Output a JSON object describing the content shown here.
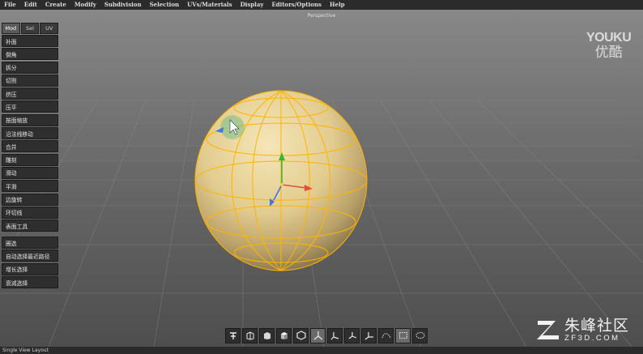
{
  "menu": [
    "File",
    "Edit",
    "Create",
    "Modify",
    "Subdivision",
    "Selection",
    "UVs/Materials",
    "Display",
    "Editors/Options",
    "Help"
  ],
  "viewport": {
    "title": "Perspective"
  },
  "panel": {
    "tabs": [
      "Mod",
      "Sel",
      "UV"
    ],
    "active_tab": "Mod",
    "tools": [
      "补面",
      "倒角",
      "拆分",
      "切割",
      "挤压",
      "压平",
      "按面缩放",
      "沿法线移动",
      "合并",
      "雕刻",
      "滑动",
      "平滑",
      "边旋转",
      "环切线",
      "表面工具"
    ],
    "selection_tools": [
      "圈选",
      "自动选择最近路径",
      "增长选择",
      "衰减选择"
    ]
  },
  "toolbar": {
    "icons": [
      "transform-icon",
      "box-open-icon",
      "cube-icon",
      "cube-shaded-icon",
      "hexagon-icon",
      "axis-y-icon",
      "axis-mid-icon",
      "axis-xyz-icon",
      "axis-xz-icon",
      "curve-icon",
      "rect-select-icon",
      "lasso-icon"
    ]
  },
  "status": {
    "text": "Single View Layout"
  },
  "watermarks": {
    "youku_en": "YOUKU",
    "youku_cn": "优酷",
    "zf_cn": "朱峰社区",
    "zf_en": "ZF3D.COM"
  },
  "colors": {
    "sphere": "#efdba3",
    "wire": "#ffb400",
    "axis_x": "#e0503c",
    "axis_y": "#3cb43c",
    "axis_z": "#3c78e0"
  }
}
